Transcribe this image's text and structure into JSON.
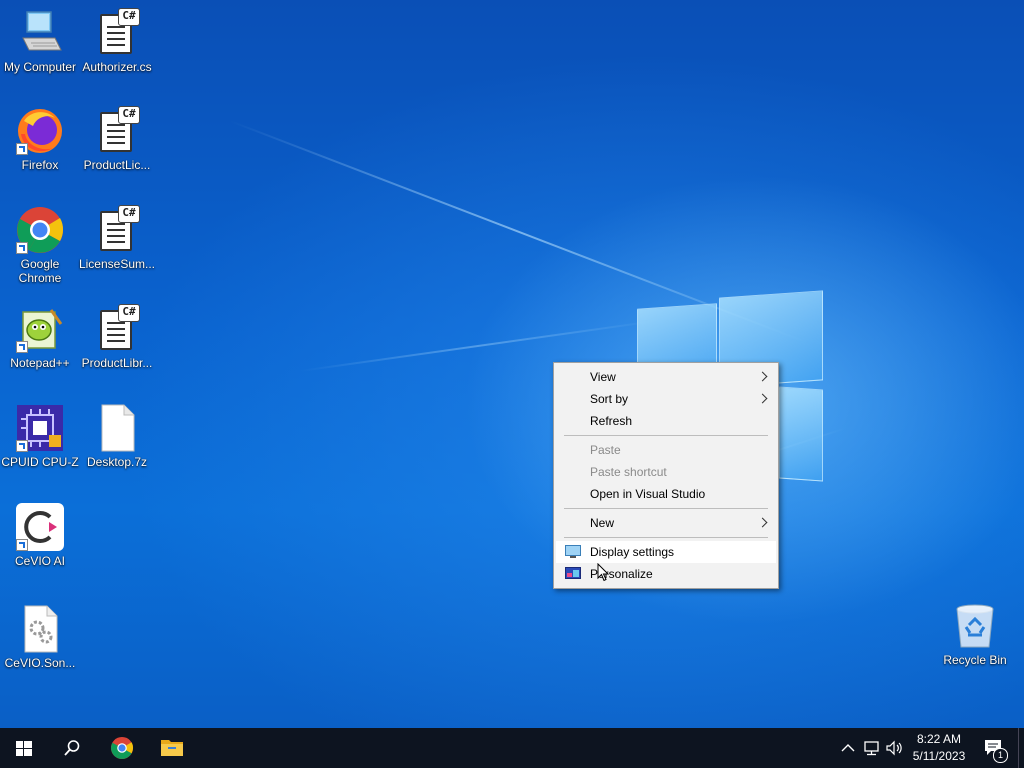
{
  "desktop_icons": [
    {
      "label": "My Computer",
      "icon": "computer-icon"
    },
    {
      "label": "Authorizer.cs",
      "icon": "csharp-file-icon"
    },
    {
      "label": "Firefox",
      "icon": "firefox-icon"
    },
    {
      "label": "ProductLic...",
      "icon": "csharp-file-icon"
    },
    {
      "label": "Google Chrome",
      "icon": "chrome-icon"
    },
    {
      "label": "LicenseSum...",
      "icon": "csharp-file-icon"
    },
    {
      "label": "Notepad++",
      "icon": "notepadpp-icon"
    },
    {
      "label": "ProductLibr...",
      "icon": "csharp-file-icon"
    },
    {
      "label": "CPUID CPU-Z",
      "icon": "cpuz-icon"
    },
    {
      "label": "Desktop.7z",
      "icon": "blank-file-icon"
    },
    {
      "label": "CeVIO AI",
      "icon": "cevio-icon"
    },
    {
      "label": "CeVIO.Son...",
      "icon": "settings-file-icon"
    },
    {
      "label": "Recycle Bin",
      "icon": "recycle-bin-icon"
    }
  ],
  "context_menu": {
    "view": "View",
    "sort_by": "Sort by",
    "refresh": "Refresh",
    "paste": "Paste",
    "paste_shortcut": "Paste shortcut",
    "open_vs": "Open in Visual Studio",
    "new": "New",
    "display_settings": "Display settings",
    "personalize": "Personalize"
  },
  "taskbar": {
    "time": "8:22 AM",
    "date": "5/11/2023",
    "notification_count": "1"
  }
}
